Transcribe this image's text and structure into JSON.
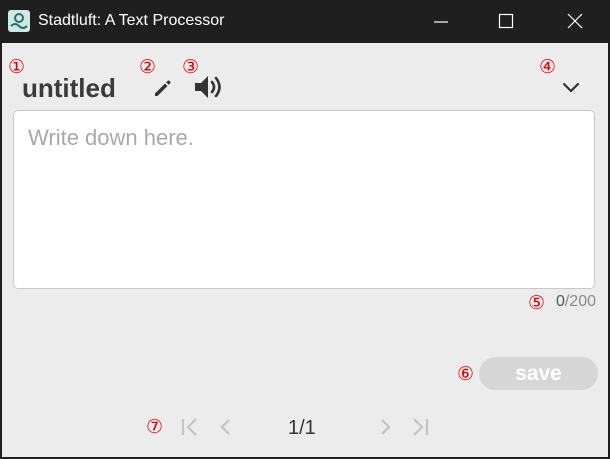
{
  "window": {
    "title": "Stadtluft: A Text Processor"
  },
  "editor": {
    "doc_title": "untitled",
    "text_placeholder": "Write down here.",
    "text_value": "",
    "char_count": "0",
    "char_limit_label": "/200",
    "save_label": "save"
  },
  "pager": {
    "page_label": "1/1"
  },
  "markers": {
    "m1": "①",
    "m2": "②",
    "m3": "③",
    "m4": "④",
    "m5": "⑤",
    "m6": "⑥",
    "m7": "⑦"
  },
  "icons": {
    "edit": "pencil-icon",
    "speak": "speaker-icon",
    "menu": "chevron-down-icon",
    "first": "first-page-icon",
    "prev": "prev-page-icon",
    "next": "next-page-icon",
    "last": "last-page-icon"
  },
  "colors": {
    "titlebar_bg": "#1f1f1f",
    "content_bg": "#ececec",
    "marker_red": "#e00000",
    "save_disabled_bg": "#d6d6d6"
  }
}
